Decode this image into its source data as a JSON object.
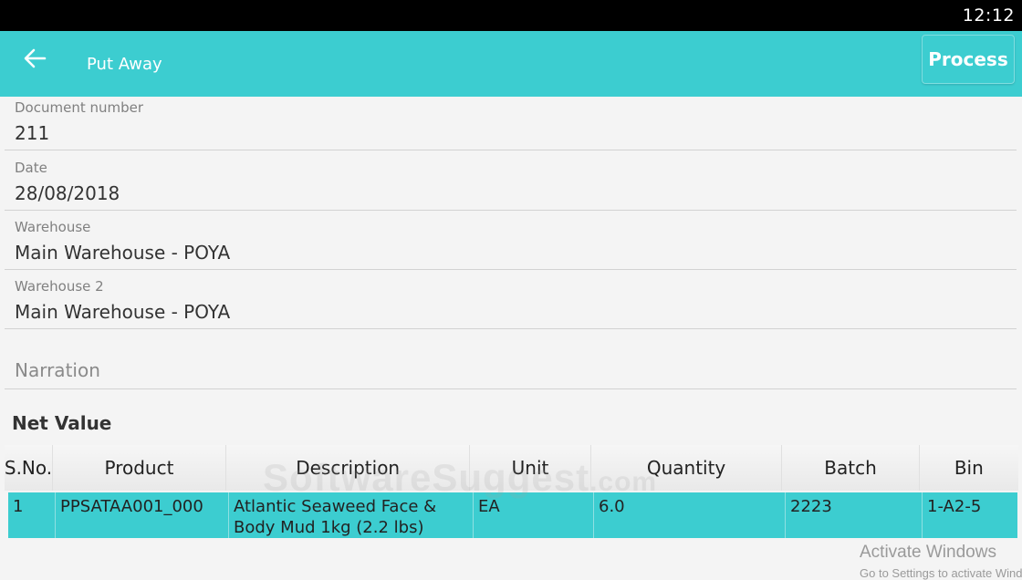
{
  "status_bar": {
    "time": "12:12"
  },
  "app_bar": {
    "back_icon": "arrow-left-icon",
    "title": "Put Away",
    "process_label": "Process",
    "color": "#3ccdd0"
  },
  "fields": [
    {
      "label": "Document number",
      "value": "211"
    },
    {
      "label": "Date",
      "value": "28/08/2018"
    },
    {
      "label": "Warehouse",
      "value": "Main Warehouse - POYA"
    },
    {
      "label": "Warehouse 2",
      "value": "Main Warehouse - POYA"
    }
  ],
  "narration": {
    "placeholder": "Narration"
  },
  "net_value_label": "Net Value",
  "table": {
    "columns": [
      "S.No.",
      "Product",
      "Description",
      "Unit",
      "Quantity",
      "Batch",
      "Bin"
    ],
    "rows": [
      {
        "sno": "1",
        "product": "PPSATAA001_000",
        "description": "Atlantic Seaweed Face & Body Mud 1kg (2.2 lbs)",
        "unit": "EA",
        "quantity": "6.0",
        "batch": "2223",
        "bin": "1-A2-5"
      }
    ],
    "selected_row_color": "#3ccdd0"
  },
  "watermark": {
    "main": "SoftwareSuggest",
    "suffix": ".com"
  },
  "windows_overlay": {
    "title": "Activate Windows",
    "subtitle": "Go to Settings to activate Windows."
  }
}
